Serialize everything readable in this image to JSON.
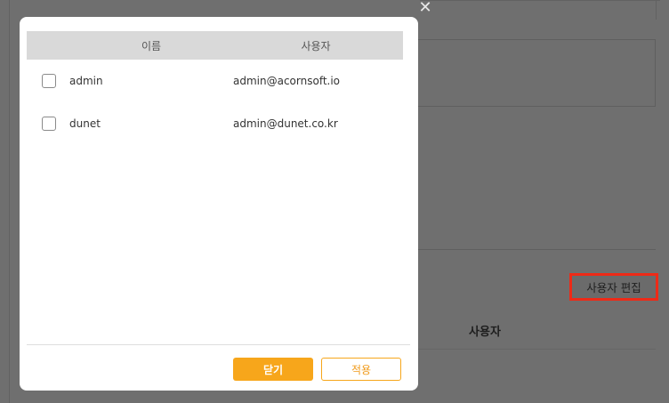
{
  "background": {
    "close_icon_glyph": "✕",
    "edit_users_button": "사용자 편집",
    "table_header_user": "사용자"
  },
  "modal": {
    "table": {
      "columns": [
        "이름",
        "사용자"
      ],
      "rows": [
        {
          "name": "admin",
          "email": "admin@acornsoft.io",
          "checked": false
        },
        {
          "name": "dunet",
          "email": "admin@dunet.co.kr",
          "checked": false
        }
      ]
    },
    "buttons": {
      "close_label": "닫기",
      "apply_label": "적용"
    }
  },
  "colors": {
    "accent": "#f7a61b",
    "overlay": "#6f6f6f",
    "highlight_border": "#ee2a17"
  }
}
